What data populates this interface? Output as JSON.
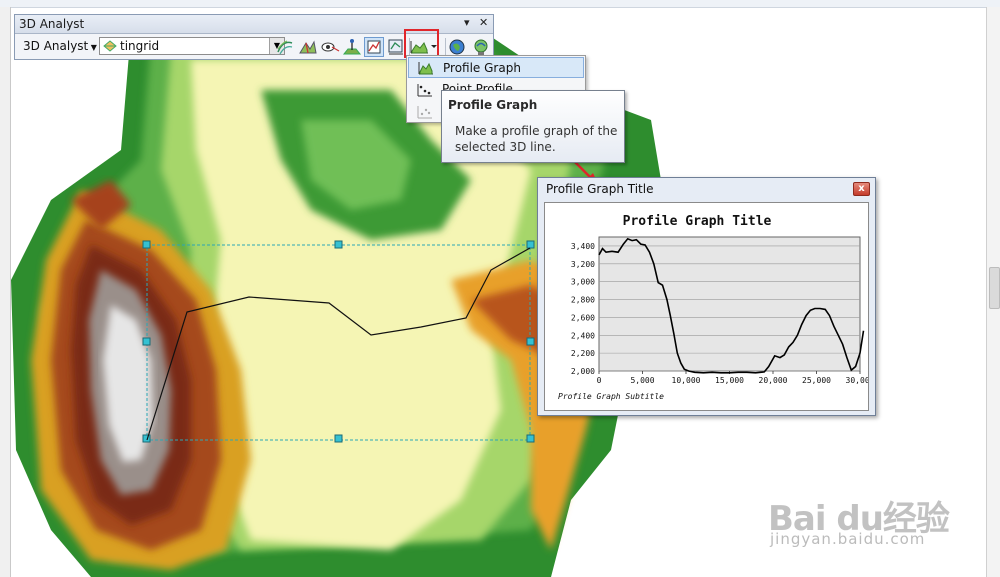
{
  "toolbar": {
    "title": "3D Analyst",
    "pin_glyph": "▾",
    "close_glyph": "✕",
    "menu_label": "3D Analyst",
    "layer_value": "tingrid",
    "icons": [
      "contour-icon",
      "steepest-path-icon",
      "line-of-sight-icon",
      "interpolate-point-icon",
      "interpolate-line-icon",
      "interpolate-polygon-icon",
      "profile-graph-icon",
      "globe-icon",
      "arcscene-icon"
    ]
  },
  "dropdown": {
    "items": [
      {
        "label": "Profile Graph",
        "state": "selected"
      },
      {
        "label": "Point Profile",
        "state": "normal"
      },
      {
        "label": "",
        "state": "disabled"
      }
    ]
  },
  "tooltip": {
    "title": "Profile Graph",
    "body": "Make a profile graph of the selected 3D line."
  },
  "graph_window": {
    "title": "Profile Graph Title",
    "close_glyph": "x"
  },
  "chart_data": {
    "type": "line",
    "title": "Profile Graph Title",
    "subtitle": "Profile Graph Subtitle",
    "xlim": [
      0,
      30000
    ],
    "ylim": [
      2000,
      3500
    ],
    "x_ticks": [
      0,
      5000,
      10000,
      15000,
      20000,
      25000,
      30000
    ],
    "x_tick_labels": [
      "0",
      "5,000",
      "10,000",
      "15,000",
      "20,000",
      "25,000",
      "30,000"
    ],
    "y_ticks": [
      2000,
      2200,
      2400,
      2600,
      2800,
      3000,
      3200,
      3400
    ],
    "y_tick_labels": [
      "2,000",
      "2,200",
      "2,400",
      "2,600",
      "2,800",
      "3,000",
      "3,200",
      "3,400"
    ],
    "grid": true,
    "series": [
      {
        "color": "#000000",
        "x": [
          0,
          400,
          800,
          1500,
          2200,
          2800,
          3300,
          3800,
          4300,
          4800,
          5300,
          5800,
          6300,
          6800,
          7300,
          7800,
          8200,
          8600,
          9000,
          9400,
          9800,
          10300,
          11000,
          12000,
          13000,
          14000,
          15000,
          16000,
          17000,
          18000,
          19000,
          19500,
          20200,
          20800,
          21300,
          21800,
          22300,
          22800,
          23300,
          23800,
          24300,
          24800,
          25400,
          26000,
          26500,
          27000,
          27500,
          28000,
          28500,
          29000,
          29500,
          30000,
          30400
        ],
        "y": [
          3300,
          3370,
          3330,
          3340,
          3330,
          3420,
          3480,
          3460,
          3470,
          3420,
          3410,
          3330,
          3200,
          2990,
          2960,
          2800,
          2620,
          2420,
          2200,
          2090,
          2020,
          2000,
          1985,
          1980,
          1985,
          1980,
          1980,
          1985,
          1985,
          1980,
          1990,
          2050,
          2170,
          2150,
          2180,
          2270,
          2320,
          2400,
          2520,
          2620,
          2680,
          2700,
          2700,
          2690,
          2620,
          2500,
          2400,
          2300,
          2150,
          2010,
          2050,
          2200,
          2450
        ]
      }
    ]
  },
  "watermark": {
    "logo": "Bai du经验",
    "url": "jingyan.baidu.com"
  }
}
